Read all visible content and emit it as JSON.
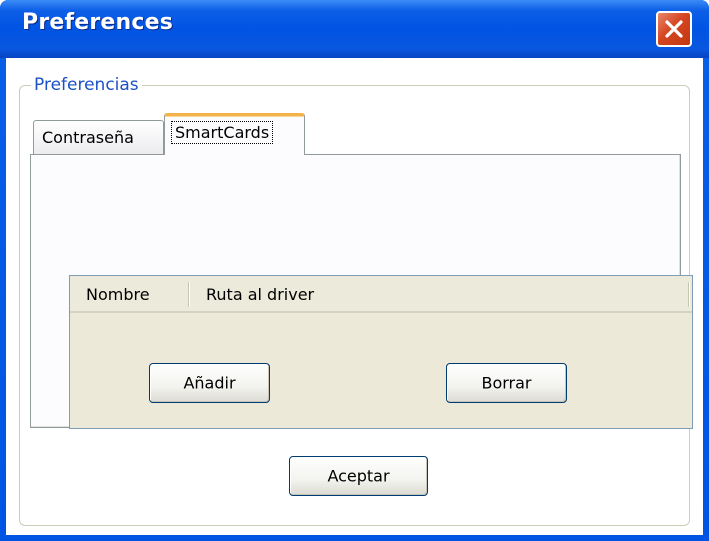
{
  "window": {
    "title": "Preferences"
  },
  "group": {
    "legend": "Preferencias"
  },
  "tabs": [
    {
      "label": "Contraseña",
      "selected": false
    },
    {
      "label": "SmartCards",
      "selected": true
    }
  ],
  "list": {
    "columns": [
      "Nombre",
      "Ruta al driver"
    ],
    "rows": []
  },
  "buttons": {
    "add_label": "Añadir",
    "delete_label": "Borrar",
    "accept_label": "Aceptar"
  },
  "icons": {
    "close": "close-icon"
  },
  "colors": {
    "titlebar": "#0054e3",
    "close_button": "#d54622",
    "legend_text": "#1b51c6",
    "active_tab_accent": "#f4b24a"
  }
}
